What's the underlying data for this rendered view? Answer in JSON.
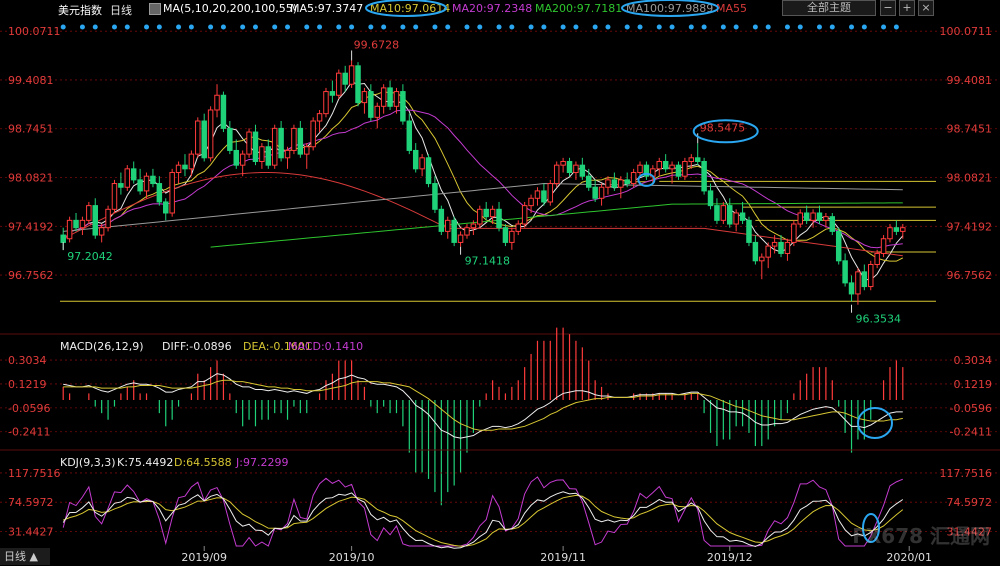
{
  "header": {
    "symbol": "美元指数",
    "period": "日线",
    "ma_title": "MA(5,10,20,200,100,55)",
    "ma5": "MA5:97.3747",
    "ma10": "MA10:97.0614",
    "ma20": "MA20:97.2348",
    "ma200": "MA200:97.7181",
    "ma100": "MA100:97.9889",
    "ma55": "MA55",
    "theme_select": "全部主题",
    "bottom_tab": "日线 ▲",
    "watermark": "FX678 汇通网"
  },
  "colors": {
    "up": "#ff3b3b",
    "down": "#1fd27a",
    "ma5": "#e8e8e8",
    "ma10": "#d6c632",
    "ma20": "#c43bd0",
    "ma200": "#2ec52e",
    "ma100": "#9a9a9a",
    "ma55": "#d83a3a",
    "grid": "#7a0b0b",
    "axis_text": "#e23b3b",
    "hline": "#d6c632",
    "circle": "#2aa7f0"
  },
  "chart_data": [
    {
      "type": "candlestick",
      "title": "美元指数 日线",
      "ylim": [
        96.2,
        100.25
      ],
      "y_ticks": [
        "100.0711",
        "99.4081",
        "98.7451",
        "98.0821",
        "97.4192",
        "96.7562"
      ],
      "y_tick_values": [
        100.0711,
        99.4081,
        98.7451,
        98.0821,
        97.4192,
        96.7562
      ],
      "x_ticks": [
        "2019/09",
        "2019/10",
        "2019/11",
        "2019/12",
        "2020/01"
      ],
      "x_tick_index": [
        22,
        45,
        78,
        104,
        132
      ],
      "annotations": [
        {
          "text": "99.6728",
          "index": 45,
          "value": 99.6728,
          "kind": "high"
        },
        {
          "text": "98.5475",
          "index": 99,
          "value": 98.5475,
          "kind": "high"
        },
        {
          "text": "97.2042",
          "index": 0,
          "value": 97.2042,
          "kind": "low"
        },
        {
          "text": "97.1418",
          "index": 62,
          "value": 97.1418,
          "kind": "low"
        },
        {
          "text": "96.3534",
          "index": 123,
          "value": 96.3534,
          "kind": "low"
        }
      ],
      "horizontal_lines": [
        98.03,
        97.68,
        97.5,
        97.07,
        96.4
      ],
      "candles": [
        [
          97.3,
          97.4,
          97.1,
          97.2
        ],
        [
          97.25,
          97.55,
          97.2,
          97.5
        ],
        [
          97.5,
          97.6,
          97.35,
          97.4
        ],
        [
          97.4,
          97.55,
          97.3,
          97.5
        ],
        [
          97.5,
          97.75,
          97.45,
          97.7
        ],
        [
          97.7,
          97.8,
          97.25,
          97.3
        ],
        [
          97.3,
          97.45,
          97.2,
          97.4
        ],
        [
          97.4,
          97.7,
          97.35,
          97.65
        ],
        [
          97.65,
          98.05,
          97.6,
          98.0
        ],
        [
          98.0,
          98.15,
          97.85,
          97.95
        ],
        [
          97.95,
          98.25,
          97.9,
          98.2
        ],
        [
          98.2,
          98.3,
          98.0,
          98.05
        ],
        [
          98.05,
          98.2,
          97.85,
          97.9
        ],
        [
          97.9,
          98.15,
          97.8,
          98.1
        ],
        [
          98.1,
          98.2,
          97.95,
          98.0
        ],
        [
          98.0,
          98.1,
          97.7,
          97.75
        ],
        [
          97.75,
          97.8,
          97.5,
          97.6
        ],
        [
          97.6,
          98.2,
          97.55,
          98.15
        ],
        [
          98.15,
          98.3,
          98.0,
          98.25
        ],
        [
          98.25,
          98.4,
          98.1,
          98.2
        ],
        [
          98.2,
          98.45,
          98.1,
          98.4
        ],
        [
          98.4,
          98.9,
          98.35,
          98.85
        ],
        [
          98.85,
          98.95,
          98.3,
          98.35
        ],
        [
          98.35,
          99.05,
          98.3,
          99.0
        ],
        [
          99.0,
          99.35,
          98.9,
          99.2
        ],
        [
          99.2,
          99.25,
          98.7,
          98.75
        ],
        [
          98.75,
          98.85,
          98.4,
          98.45
        ],
        [
          98.45,
          98.6,
          98.2,
          98.25
        ],
        [
          98.25,
          98.45,
          98.1,
          98.4
        ],
        [
          98.4,
          98.75,
          98.35,
          98.7
        ],
        [
          98.7,
          98.8,
          98.25,
          98.3
        ],
        [
          98.3,
          98.55,
          98.2,
          98.5
        ],
        [
          98.5,
          98.6,
          98.2,
          98.25
        ],
        [
          98.25,
          98.8,
          98.2,
          98.75
        ],
        [
          98.75,
          98.85,
          98.3,
          98.35
        ],
        [
          98.35,
          98.5,
          98.2,
          98.45
        ],
        [
          98.45,
          98.8,
          98.4,
          98.75
        ],
        [
          98.75,
          98.85,
          98.35,
          98.4
        ],
        [
          98.4,
          98.55,
          98.2,
          98.5
        ],
        [
          98.5,
          98.9,
          98.45,
          98.85
        ],
        [
          98.85,
          99.0,
          98.7,
          98.95
        ],
        [
          98.95,
          99.3,
          98.9,
          99.25
        ],
        [
          99.25,
          99.4,
          99.1,
          99.2
        ],
        [
          99.2,
          99.55,
          99.15,
          99.5
        ],
        [
          99.5,
          99.6,
          99.25,
          99.35
        ],
        [
          99.35,
          99.6728,
          99.3,
          99.6
        ],
        [
          99.6,
          99.65,
          99.05,
          99.1
        ],
        [
          99.1,
          99.3,
          98.95,
          99.25
        ],
        [
          99.25,
          99.35,
          98.85,
          98.9
        ],
        [
          98.9,
          99.1,
          98.75,
          99.05
        ],
        [
          99.05,
          99.35,
          98.95,
          99.3
        ],
        [
          99.3,
          99.4,
          99.0,
          99.05
        ],
        [
          99.05,
          99.3,
          98.95,
          99.25
        ],
        [
          99.25,
          99.35,
          98.8,
          98.85
        ],
        [
          98.85,
          98.95,
          98.4,
          98.45
        ],
        [
          98.45,
          98.55,
          98.15,
          98.2
        ],
        [
          98.2,
          98.4,
          98.1,
          98.35
        ],
        [
          98.35,
          98.4,
          97.95,
          98.0
        ],
        [
          98.0,
          98.1,
          97.6,
          97.65
        ],
        [
          97.65,
          97.7,
          97.3,
          97.35
        ],
        [
          97.35,
          97.55,
          97.25,
          97.5
        ],
        [
          97.5,
          97.55,
          97.15,
          97.2
        ],
        [
          97.2,
          97.35,
          97.1418,
          97.3
        ],
        [
          97.3,
          97.45,
          97.25,
          97.4
        ],
        [
          97.4,
          97.5,
          97.3,
          97.45
        ],
        [
          97.45,
          97.7,
          97.4,
          97.65
        ],
        [
          97.65,
          97.75,
          97.5,
          97.55
        ],
        [
          97.55,
          97.7,
          97.45,
          97.65
        ],
        [
          97.65,
          97.75,
          97.35,
          97.4
        ],
        [
          97.4,
          97.45,
          97.15,
          97.2
        ],
        [
          97.2,
          97.4,
          97.1,
          97.35
        ],
        [
          97.35,
          97.5,
          97.3,
          97.45
        ],
        [
          97.45,
          97.75,
          97.4,
          97.7
        ],
        [
          97.7,
          97.85,
          97.6,
          97.8
        ],
        [
          97.8,
          97.95,
          97.7,
          97.9
        ],
        [
          97.9,
          98.0,
          97.7,
          97.75
        ],
        [
          97.75,
          98.05,
          97.7,
          98.0
        ],
        [
          98.0,
          98.3,
          97.95,
          98.25
        ],
        [
          98.25,
          98.35,
          98.15,
          98.3
        ],
        [
          98.3,
          98.35,
          98.1,
          98.15
        ],
        [
          98.15,
          98.3,
          98.05,
          98.25
        ],
        [
          98.25,
          98.35,
          98.05,
          98.1
        ],
        [
          98.1,
          98.2,
          97.9,
          97.95
        ],
        [
          97.95,
          98.05,
          97.75,
          97.8
        ],
        [
          97.8,
          98.0,
          97.7,
          97.95
        ],
        [
          97.95,
          98.1,
          97.85,
          98.05
        ],
        [
          98.05,
          98.15,
          97.9,
          97.95
        ],
        [
          97.95,
          98.1,
          97.8,
          98.05
        ],
        [
          98.05,
          98.15,
          97.95,
          98.0
        ],
        [
          98.0,
          98.2,
          97.95,
          98.15
        ],
        [
          98.15,
          98.3,
          98.1,
          98.25
        ],
        [
          98.25,
          98.3,
          98.05,
          98.1
        ],
        [
          98.1,
          98.25,
          98.0,
          98.2
        ],
        [
          98.2,
          98.35,
          98.1,
          98.3
        ],
        [
          98.3,
          98.4,
          98.15,
          98.2
        ],
        [
          98.2,
          98.3,
          98.0,
          98.25
        ],
        [
          98.25,
          98.3,
          98.05,
          98.1
        ],
        [
          98.1,
          98.35,
          98.05,
          98.3
        ],
        [
          98.3,
          98.4,
          98.2,
          98.35
        ],
        [
          98.35,
          98.5475,
          98.25,
          98.3
        ],
        [
          98.3,
          98.35,
          97.85,
          97.9
        ],
        [
          97.9,
          98.0,
          97.65,
          97.7
        ],
        [
          97.7,
          97.8,
          97.45,
          97.5
        ],
        [
          97.5,
          97.75,
          97.45,
          97.7
        ],
        [
          97.7,
          97.8,
          97.4,
          97.45
        ],
        [
          97.45,
          97.65,
          97.35,
          97.6
        ],
        [
          97.6,
          97.75,
          97.45,
          97.5
        ],
        [
          97.5,
          97.55,
          97.15,
          97.2
        ],
        [
          97.2,
          97.3,
          96.9,
          96.95
        ],
        [
          96.95,
          97.05,
          96.7,
          97.0
        ],
        [
          97.0,
          97.2,
          96.85,
          97.15
        ],
        [
          97.15,
          97.3,
          97.05,
          97.2
        ],
        [
          97.2,
          97.3,
          97.0,
          97.05
        ],
        [
          97.05,
          97.25,
          96.95,
          97.2
        ],
        [
          97.2,
          97.5,
          97.15,
          97.45
        ],
        [
          97.45,
          97.65,
          97.4,
          97.6
        ],
        [
          97.6,
          97.7,
          97.45,
          97.5
        ],
        [
          97.5,
          97.65,
          97.4,
          97.6
        ],
        [
          97.6,
          97.7,
          97.45,
          97.5
        ],
        [
          97.5,
          97.6,
          97.4,
          97.55
        ],
        [
          97.55,
          97.6,
          97.3,
          97.35
        ],
        [
          97.35,
          97.4,
          96.9,
          96.95
        ],
        [
          96.95,
          97.05,
          96.6,
          96.65
        ],
        [
          96.65,
          96.75,
          96.4,
          96.5
        ],
        [
          96.5,
          96.85,
          96.3534,
          96.8
        ],
        [
          96.8,
          96.9,
          96.55,
          96.6
        ],
        [
          96.6,
          96.95,
          96.55,
          96.9
        ],
        [
          96.9,
          97.1,
          96.85,
          97.05
        ],
        [
          97.05,
          97.3,
          97.0,
          97.25
        ],
        [
          97.25,
          97.45,
          97.2,
          97.4
        ],
        [
          97.4,
          97.5,
          97.3,
          97.35
        ],
        [
          97.35,
          97.45,
          97.25,
          97.4
        ]
      ],
      "series": [
        {
          "name": "MA5",
          "values": []
        },
        {
          "name": "MA10",
          "values": []
        },
        {
          "name": "MA20",
          "values": []
        },
        {
          "name": "MA55",
          "values": []
        },
        {
          "name": "MA100",
          "values": []
        },
        {
          "name": "MA200",
          "values": []
        }
      ]
    },
    {
      "type": "bar",
      "title": "MACD(26,12,9)",
      "labels": {
        "diff": "DIFF:-0.0896",
        "dea": "DEA:-0.1601",
        "macd": "MACD:0.1410"
      },
      "ylim": [
        -0.38,
        0.38
      ],
      "y_ticks": [
        "0.3034",
        "0.1219",
        "-0.0596",
        "-0.2411"
      ],
      "y_tick_values": [
        0.3034,
        0.1219,
        -0.0596,
        -0.2411
      ],
      "diff": [
        0.12,
        0.11,
        0.1,
        0.1,
        0.11,
        0.09,
        0.07,
        0.06,
        0.08,
        0.1,
        0.12,
        0.13,
        0.12,
        0.12,
        0.11,
        0.09,
        0.06,
        0.06,
        0.08,
        0.09,
        0.1,
        0.14,
        0.14,
        0.17,
        0.2,
        0.19,
        0.16,
        0.12,
        0.1,
        0.1,
        0.08,
        0.08,
        0.07,
        0.08,
        0.07,
        0.06,
        0.07,
        0.06,
        0.05,
        0.07,
        0.08,
        0.11,
        0.13,
        0.16,
        0.17,
        0.19,
        0.17,
        0.16,
        0.13,
        0.12,
        0.12,
        0.11,
        0.1,
        0.07,
        0.02,
        -0.04,
        -0.07,
        -0.11,
        -0.17,
        -0.23,
        -0.25,
        -0.28,
        -0.29,
        -0.28,
        -0.27,
        -0.24,
        -0.22,
        -0.2,
        -0.2,
        -0.21,
        -0.2,
        -0.18,
        -0.15,
        -0.11,
        -0.07,
        -0.05,
        -0.02,
        0.02,
        0.05,
        0.06,
        0.07,
        0.07,
        0.06,
        0.04,
        0.03,
        0.03,
        0.02,
        0.02,
        0.02,
        0.03,
        0.04,
        0.04,
        0.04,
        0.05,
        0.05,
        0.05,
        0.04,
        0.05,
        0.06,
        0.06,
        0.02,
        -0.02,
        -0.06,
        -0.07,
        -0.09,
        -0.09,
        -0.1,
        -0.13,
        -0.17,
        -0.19,
        -0.19,
        -0.18,
        -0.18,
        -0.17,
        -0.14,
        -0.11,
        -0.09,
        -0.07,
        -0.06,
        -0.05,
        -0.06,
        -0.1,
        -0.15,
        -0.2,
        -0.2,
        -0.21,
        -0.19,
        -0.16,
        -0.13,
        -0.1,
        -0.09,
        -0.09
      ],
      "dea": [
        0.1,
        0.1,
        0.1,
        0.1,
        0.1,
        0.1,
        0.09,
        0.09,
        0.09,
        0.09,
        0.1,
        0.1,
        0.11,
        0.11,
        0.11,
        0.11,
        0.1,
        0.09,
        0.09,
        0.09,
        0.09,
        0.1,
        0.11,
        0.12,
        0.14,
        0.15,
        0.15,
        0.14,
        0.14,
        0.13,
        0.12,
        0.11,
        0.1,
        0.1,
        0.09,
        0.09,
        0.08,
        0.08,
        0.07,
        0.07,
        0.07,
        0.08,
        0.09,
        0.1,
        0.11,
        0.13,
        0.14,
        0.14,
        0.14,
        0.14,
        0.13,
        0.13,
        0.12,
        0.11,
        0.1,
        0.07,
        0.04,
        0.01,
        -0.03,
        -0.07,
        -0.11,
        -0.15,
        -0.18,
        -0.2,
        -0.22,
        -0.23,
        -0.23,
        -0.23,
        -0.22,
        -0.22,
        -0.22,
        -0.21,
        -0.2,
        -0.18,
        -0.16,
        -0.14,
        -0.11,
        -0.09,
        -0.06,
        -0.04,
        -0.02,
        -0.01,
        0.0,
        0.01,
        0.01,
        0.02,
        0.02,
        0.02,
        0.02,
        0.02,
        0.03,
        0.03,
        0.03,
        0.04,
        0.04,
        0.04,
        0.04,
        0.04,
        0.05,
        0.05,
        0.04,
        0.03,
        0.01,
        -0.01,
        -0.03,
        -0.05,
        -0.06,
        -0.08,
        -0.1,
        -0.12,
        -0.13,
        -0.14,
        -0.15,
        -0.15,
        -0.15,
        -0.14,
        -0.13,
        -0.12,
        -0.11,
        -0.1,
        -0.09,
        -0.09,
        -0.1,
        -0.12,
        -0.14,
        -0.15,
        -0.16,
        -0.16,
        -0.16,
        -0.15,
        -0.15,
        -0.14
      ]
    },
    {
      "type": "line",
      "title": "KDJ(9,3,3)",
      "labels": {
        "k": "K:75.4492",
        "d": "D:64.5588",
        "j": "J:97.2299"
      },
      "ylim": [
        10,
        128
      ],
      "y_ticks": [
        "117.7516",
        "74.5972",
        "31.4427"
      ],
      "y_tick_values": [
        117.7516,
        74.5972,
        31.4427
      ]
    }
  ]
}
